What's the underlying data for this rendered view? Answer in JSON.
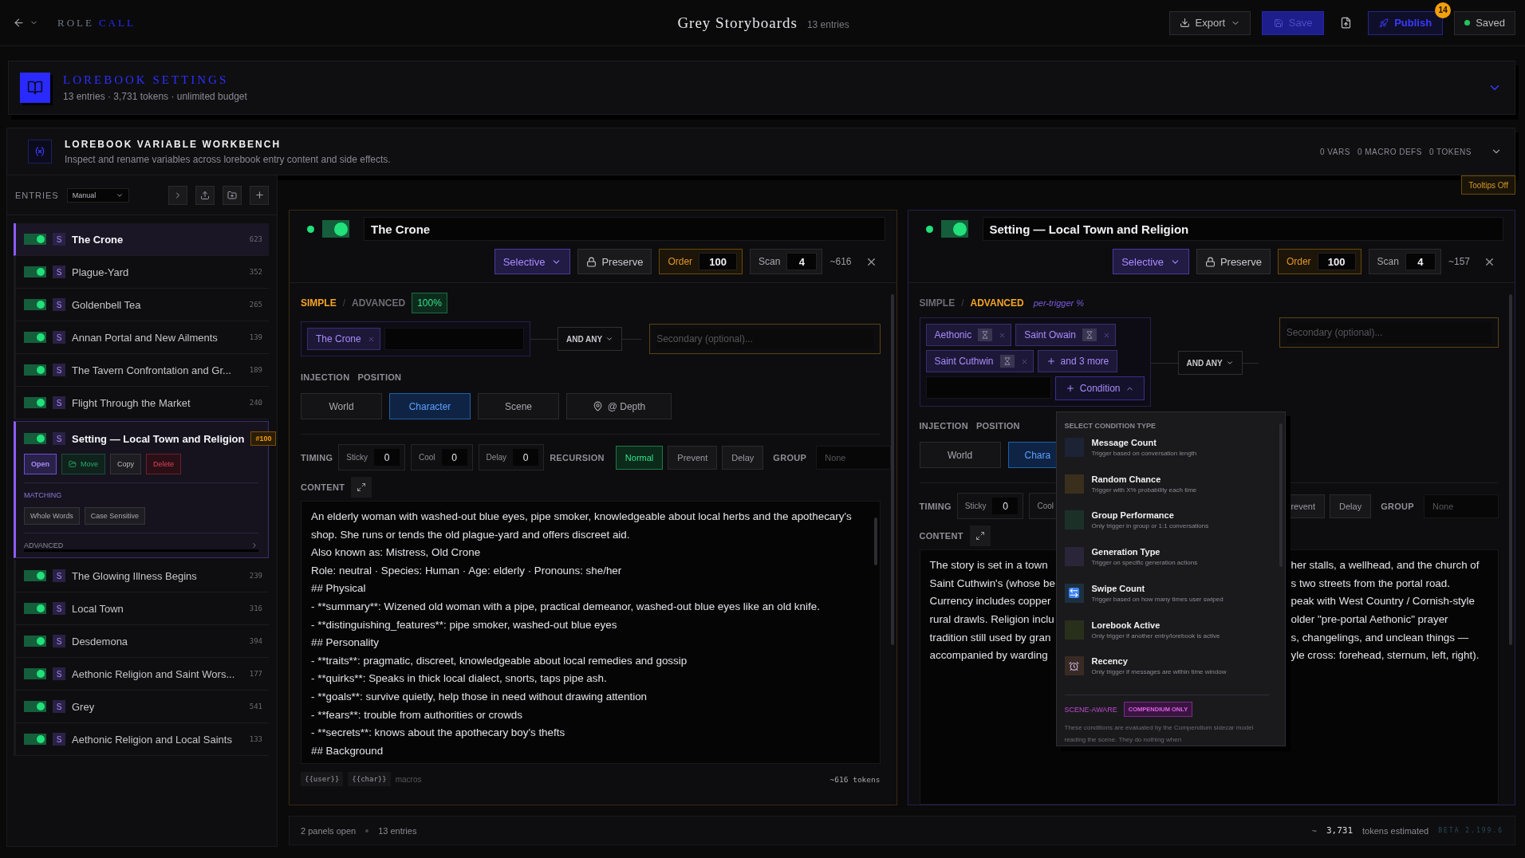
{
  "top_bar": {
    "brand": [
      {
        "text": "ROLE",
        "accent": false
      },
      {
        "text": "CALL",
        "accent": true
      }
    ],
    "title": "Grey Storyboards",
    "subtitle": "13 entries",
    "actions": [
      {
        "kind": "menu",
        "label": "Export"
      },
      {
        "kind": "primary",
        "label": "Save"
      },
      {
        "kind": "icon"
      },
      {
        "kind": "publish",
        "label": "Publish",
        "badge": "14"
      },
      {
        "kind": "status",
        "label": "Saved"
      }
    ]
  },
  "settings": {
    "title": "LOREBOOK SETTINGS",
    "summary": "13 entries · 3,731 tokens · unlimited budget"
  },
  "workbench": {
    "title": "LOREBOOK VARIABLE WORKBENCH",
    "description": "Inspect and rename variables across lorebook entry content and side effects.",
    "stats": [
      "0 VARS",
      "0 MACRO DEFS",
      "0 TOKENS"
    ]
  },
  "tooltips": {
    "label": "Tooltips Off"
  },
  "sidebar": {
    "label": "ENTRIES",
    "sort": "Manual",
    "entries": [
      {
        "name": "The Crone",
        "tokens": "623",
        "badge": "S",
        "enabled": true,
        "selected": true,
        "expanded": false
      },
      {
        "name": "Plague-Yard",
        "tokens": "352",
        "badge": "S",
        "enabled": true,
        "selected": false,
        "expanded": false
      },
      {
        "name": "Goldenbell Tea",
        "tokens": "265",
        "badge": "S",
        "enabled": true,
        "selected": false,
        "expanded": false
      },
      {
        "name": "Annan Portal and New Ailments",
        "tokens": "139",
        "badge": "S",
        "enabled": true,
        "selected": false,
        "expanded": false
      },
      {
        "name": "The Tavern Confrontation and Gr...",
        "tokens": "189",
        "badge": "S",
        "enabled": true,
        "selected": false,
        "expanded": false
      },
      {
        "name": "Flight Through the Market",
        "tokens": "240",
        "badge": "S",
        "enabled": true,
        "selected": false,
        "expanded": false
      },
      {
        "name": "Setting — Local Town and Religion",
        "badge": "S",
        "enabled": true,
        "selected": false,
        "expanded": true,
        "details": {
          "order": "#100",
          "actions": [
            {
              "label": "Open",
              "kind": "open"
            },
            {
              "label": "Move",
              "kind": "move"
            },
            {
              "label": "Copy",
              "kind": "copy"
            },
            {
              "label": "Delete",
              "kind": "delete"
            }
          ],
          "matching_label": "MATCHING",
          "matching": [
            "Whole Words",
            "Case Sensitive"
          ],
          "advanced_label": "ADVANCED"
        }
      },
      {
        "name": "The Glowing Illness Begins",
        "tokens": "239",
        "badge": "S",
        "enabled": true,
        "selected": false,
        "expanded": false
      },
      {
        "name": "Local Town",
        "tokens": "316",
        "badge": "S",
        "enabled": true,
        "selected": false,
        "expanded": false
      },
      {
        "name": "Desdemona",
        "tokens": "394",
        "badge": "S",
        "enabled": true,
        "selected": false,
        "expanded": false
      },
      {
        "name": "Aethonic Religion and Saint Wors...",
        "tokens": "177",
        "badge": "S",
        "enabled": true,
        "selected": false,
        "expanded": false
      },
      {
        "name": "Grey",
        "tokens": "541",
        "badge": "S",
        "enabled": true,
        "selected": false,
        "expanded": false
      },
      {
        "name": "Aethonic Religion and Local Saints",
        "tokens": "133",
        "badge": "S",
        "enabled": true,
        "selected": false,
        "expanded": false
      }
    ]
  },
  "panels": [
    {
      "title": "The Crone",
      "active": true,
      "enabled": true,
      "strategy": "Selective",
      "preserve": "Preserve",
      "order_label": "Order",
      "order": "100",
      "scan_label": "Scan",
      "scan": "4",
      "tokens": "~616",
      "modes": [
        {
          "label": "SIMPLE",
          "selected": true
        },
        {
          "label": "ADVANCED",
          "selected": false
        }
      ],
      "mode_separator": "/",
      "mode_badge": {
        "kind": "percent",
        "text": "100%"
      },
      "keywords": [
        {
          "label": "The Crone",
          "timed": false
        }
      ],
      "logic": "AND ANY",
      "secondary_placeholder": "Secondary (optional)...",
      "injection_label": "INJECTION",
      "position_label": "POSITION",
      "positions": [
        {
          "label": "World",
          "selected": false,
          "kind": "plain"
        },
        {
          "label": "Character",
          "selected": true,
          "kind": "plain"
        },
        {
          "label": "Scene",
          "selected": false,
          "kind": "plain"
        },
        {
          "label": "@ Depth",
          "selected": false,
          "kind": "depth"
        }
      ],
      "timing_label": "TIMING",
      "timing": [
        {
          "label": "Sticky",
          "value": "0"
        },
        {
          "label": "Cool",
          "value": "0"
        },
        {
          "label": "Delay",
          "value": "0"
        }
      ],
      "recursion_label": "RECURSION",
      "recursion": [
        {
          "label": "Normal",
          "selected": true
        },
        {
          "label": "Prevent",
          "selected": false
        },
        {
          "label": "Delay",
          "selected": false
        }
      ],
      "group_label": "GROUP",
      "group_placeholder": "None",
      "content_label": "CONTENT",
      "content": [
        "An elderly woman with washed-out blue eyes, pipe smoker, knowledgeable about local herbs and the apothecary's shop. She runs or tends the old plague-yard and offers discreet aid.",
        "Also known as: Mistress, Old Crone",
        "Role: neutral · Species: Human · Age: elderly · Pronouns: she/her",
        "## Physical",
        "- **summary**: Wizened old woman with a pipe, practical demeanor, washed-out blue eyes like an old knife.",
        "- **distinguishing_features**: pipe smoker, washed-out blue eyes",
        "## Personality",
        "- **traits**: pragmatic, discreet, knowledgeable about local remedies and gossip",
        "- **quirks**: Speaks in thick local dialect, snorts, taps pipe ash.",
        "- **goals**: survive quietly, help those in need without drawing attention",
        "- **fears**: trouble from authorities or crowds",
        "- **secrets**: knows about the apothecary boy's thefts",
        "## Background"
      ],
      "macros": [
        "{{user}}",
        "{{char}}"
      ],
      "macros_label": "macros",
      "token_estimate": "~616 tokens"
    },
    {
      "title": "Setting — Local Town and Religion",
      "active": true,
      "enabled": true,
      "strategy": "Selective",
      "preserve": "Preserve",
      "order_label": "Order",
      "order": "100",
      "scan_label": "Scan",
      "scan": "4",
      "tokens": "~157",
      "modes": [
        {
          "label": "SIMPLE",
          "selected": false
        },
        {
          "label": "ADVANCED",
          "selected": true
        }
      ],
      "mode_separator": "/",
      "mode_badge": {
        "kind": "note",
        "text": "per-trigger %"
      },
      "keywords": [
        {
          "label": "Aethonic",
          "timed": true
        },
        {
          "label": "Saint Owain",
          "timed": true
        },
        {
          "label": "Saint Cuthwin",
          "timed": true
        }
      ],
      "more": "and 3 more",
      "condition": {
        "label": "Condition",
        "expanded": true
      },
      "logic": "AND ANY",
      "secondary_placeholder": "Secondary (optional)...",
      "injection_label": "INJECTION",
      "position_label": "POSITION",
      "positions": [
        {
          "label": "World",
          "selected": false,
          "kind": "plain"
        },
        {
          "label": "Chara",
          "selected": true,
          "kind": "plain"
        }
      ],
      "timing_label": "TIMING",
      "timing": [
        {
          "label": "Sticky",
          "value": "0"
        },
        {
          "label": "Cool"
        }
      ],
      "recursion": [
        {
          "label": "revent",
          "selected": false
        },
        {
          "label": "Delay",
          "selected": false
        }
      ],
      "group_label": "GROUP",
      "group_placeholder": "None",
      "content_label": "CONTENT",
      "content_rows": [
        {
          "left": "The story is set in a town",
          "right": "her stalls, a wellhead, and the church of"
        },
        {
          "left": "Saint Cuthwin's (whose be",
          "right": "s two streets from the portal road."
        },
        {
          "left": "Currency includes copper",
          "right": "peak with West Country / Cornish-style"
        },
        {
          "left": "rural drawls. Religion inclu",
          "right": "older \"pre-portal Aethonic\" prayer"
        },
        {
          "left": "tradition still used by gran",
          "right": "s, changelings, and unclean things —"
        },
        {
          "left": "accompanied by warding",
          "right": "yle cross: forehead, sternum, left, right)."
        }
      ],
      "condition_menu": {
        "heading": "SELECT CONDITION TYPE",
        "options": [
          {
            "title": "Message Count",
            "description": "Trigger based on conversation length",
            "color": "#1c2335",
            "kind": "blank"
          },
          {
            "title": "Random Chance",
            "description": "Trigger with X% probability each time",
            "color": "#3a2f1c",
            "kind": "blank"
          },
          {
            "title": "Group Performance",
            "description": "Only trigger in group or 1:1 conversations",
            "color": "#1b3128",
            "kind": "blank"
          },
          {
            "title": "Generation Type",
            "description": "Trigger on specific generation actions",
            "color": "#2a2538",
            "kind": "blank"
          },
          {
            "title": "Swipe Count",
            "description": "Trigger based on how many times user swiped",
            "color": "#1d3040",
            "kind": "swipe"
          },
          {
            "title": "Lorebook Active",
            "description": "Only trigger if another entry/lorebook is active",
            "color": "#28301c",
            "kind": "blank"
          },
          {
            "title": "Recency",
            "description": "Only trigger if messages are within time window",
            "color": "#3a2a24",
            "kind": "clock"
          }
        ],
        "section": "SCENE-AWARE",
        "section_badge": "COMPENDIUM ONLY",
        "note": "These conditions are evaluated by the Compendium sidecar model reading the scene. They do nothing when"
      }
    }
  ],
  "status_bar": {
    "panels": "2 panels open",
    "entries": "13 entries",
    "approx": "~",
    "tokens": "3,731",
    "tokens_label": "tokens estimated",
    "version": "BETA 2.199.6"
  }
}
